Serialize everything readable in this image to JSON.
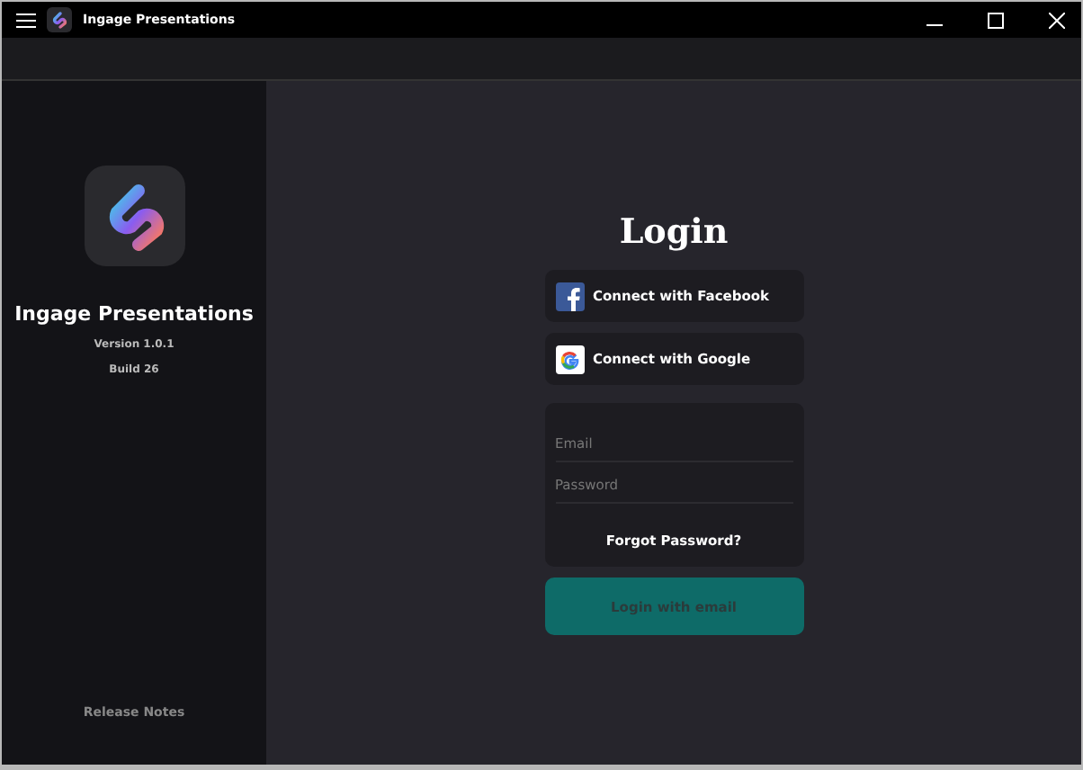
{
  "window": {
    "title": "Ingage Presentations"
  },
  "sidebar": {
    "app_name": "Ingage Presentations",
    "version": "Version 1.0.1",
    "build": "Build 26",
    "release_notes": "Release Notes"
  },
  "login": {
    "heading": "Login",
    "facebook_button": "Connect with Facebook",
    "google_button": "Connect with Google",
    "email": {
      "placeholder": "Email"
    },
    "password": {
      "placeholder": "Password"
    },
    "forgot_password": "Forgot Password?",
    "submit_button": "Login with email"
  }
}
